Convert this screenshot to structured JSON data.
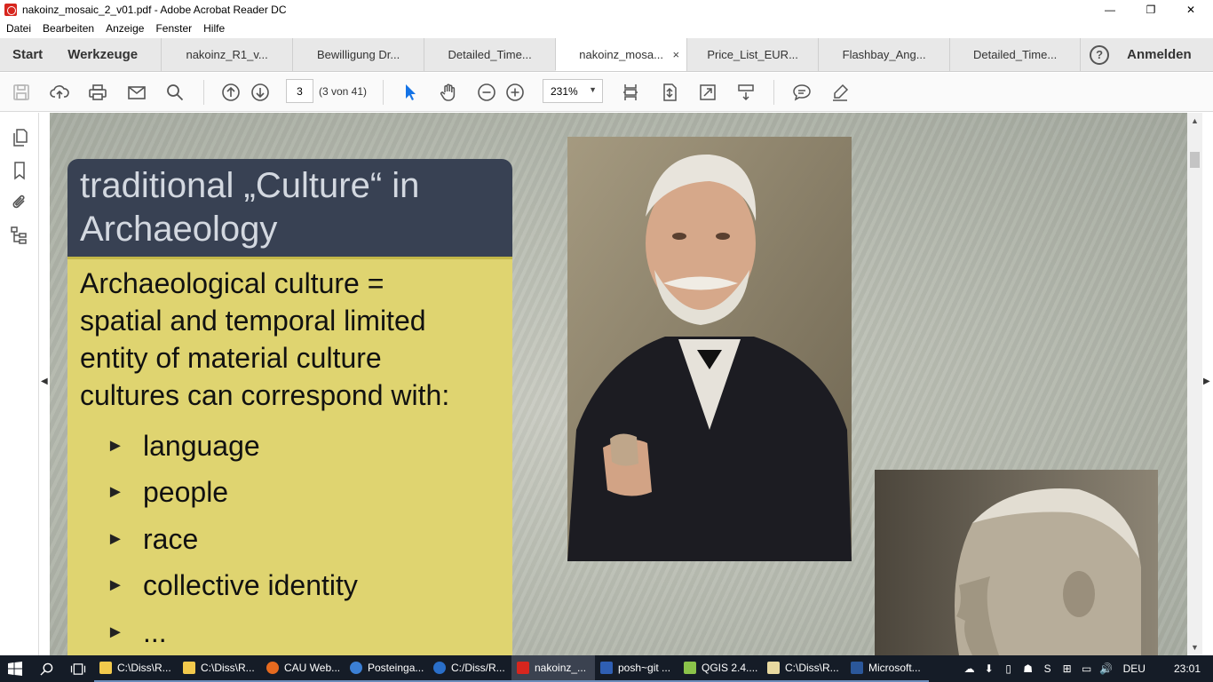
{
  "window": {
    "title": "nakoinz_mosaic_2_v01.pdf - Adobe Acrobat Reader DC",
    "minimize": "—",
    "maximize": "❐",
    "close": "✕"
  },
  "menu": [
    "Datei",
    "Bearbeiten",
    "Anzeige",
    "Fenster",
    "Hilfe"
  ],
  "tabs": {
    "start": "Start",
    "tools": "Werkzeuge",
    "documents": [
      "nakoinz_R1_v...",
      "Bewilligung Dr...",
      "Detailed_Time...",
      "nakoinz_mosa...",
      "Price_List_EUR...",
      "Flashbay_Ang...",
      "Detailed_Time..."
    ],
    "close_glyph": "×",
    "help_glyph": "?",
    "signin": "Anmelden"
  },
  "toolbar": {
    "page_number": "3",
    "page_count": "(3 von 41)",
    "zoom": "231%",
    "zoom_chevron": "▼"
  },
  "side_panel": {
    "collapse_left": "◀",
    "collapse_right": "▶"
  },
  "slide": {
    "title_lines": [
      "traditional „Culture“ in",
      "Archaeology"
    ],
    "body_lines": [
      "Archaeological culture =",
      "spatial and temporal limited",
      "entity of material culture",
      "cultures can correspond with:"
    ],
    "bullet_marker": "►",
    "bullets": [
      "language",
      "people",
      "race",
      "collective identity",
      "..."
    ]
  },
  "scrollbar": {
    "up": "▲",
    "down": "▼"
  },
  "taskbar": {
    "items": [
      {
        "label": "C:\\Diss\\R...",
        "color": "#f2c94c"
      },
      {
        "label": "C:\\Diss\\R...",
        "color": "#f2c94c"
      },
      {
        "label": "CAU Web...",
        "color": "#e66a1f"
      },
      {
        "label": "Posteinga...",
        "color": "#3b7fd4"
      },
      {
        "label": "C:/Diss/R...",
        "color": "#2a6fc9"
      },
      {
        "label": "nakoinz_...",
        "color": "#d7261e"
      },
      {
        "label": "posh~git ...",
        "color": "#2f5fb3"
      },
      {
        "label": "QGIS 2.4....",
        "color": "#8bc34a"
      },
      {
        "label": "C:\\Diss\\R...",
        "color": "#e8d9a0"
      },
      {
        "label": "Microsoft...",
        "color": "#2b579a"
      }
    ],
    "active_index": 5,
    "tray_icons": [
      "☁",
      "⬇",
      "▯",
      "☗",
      "S",
      "⊞",
      "▭",
      "🔊"
    ],
    "language": "DEU",
    "time": "23:01"
  }
}
